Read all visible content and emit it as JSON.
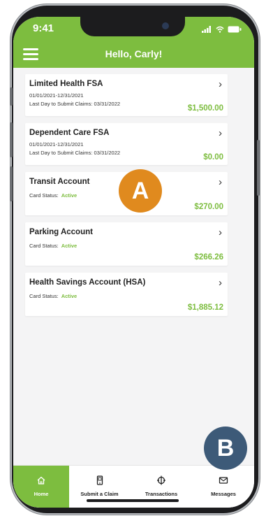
{
  "status": {
    "time": "9:41",
    "icons": "all ◒ ▬"
  },
  "header": {
    "greeting": "Hello, Carly!"
  },
  "accounts": [
    {
      "title": "Limited Health FSA",
      "dates": "01/01/2021-12/31/2021",
      "deadline": "Last Day to Submit Claims:  03/31/2022",
      "amount": "$1,500.00"
    },
    {
      "title": "Dependent Care FSA",
      "dates": "01/01/2021-12/31/2021",
      "deadline": "Last Day to Submit Claims:  03/31/2022",
      "amount": "$0.00"
    },
    {
      "title": "Transit Account",
      "status_label": "Card Status:",
      "status_value": "Active",
      "amount": "$270.00"
    },
    {
      "title": "Parking Account",
      "status_label": "Card Status:",
      "status_value": "Active",
      "amount": "$266.26"
    },
    {
      "title": "Health Savings Account (HSA)",
      "status_label": "Card Status:",
      "status_value": "Active",
      "amount": "$1,885.12"
    }
  ],
  "badges": {
    "a": "A",
    "b": "B",
    "a_color": "#e08a1e",
    "b_color": "#3d5a78"
  },
  "tabs": [
    {
      "label": "Home",
      "icon": "home-icon"
    },
    {
      "label": "Submit a Claim",
      "icon": "phone-icon"
    },
    {
      "label": "Transactions",
      "icon": "transactions-icon"
    },
    {
      "label": "Messages",
      "icon": "envelope-icon"
    }
  ],
  "colors": {
    "brand": "#7dbd3f"
  }
}
